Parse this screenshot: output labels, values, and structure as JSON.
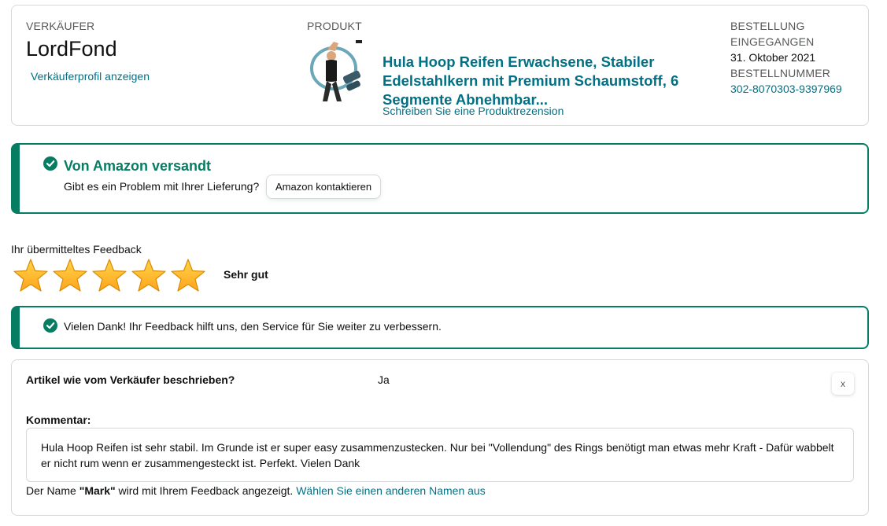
{
  "order": {
    "seller_label": "VERKÄUFER",
    "seller_name": "LordFond",
    "seller_profile_link": "Verkäuferprofil anzeigen",
    "product_label": "PRODUKT",
    "product_title": "Hula Hoop Reifen Erwachsene, Stabiler Edelstahlkern mit Premium Schaumstoff, 6 Segmente Abnehmbar...",
    "product_review_link": "Schreiben Sie eine Produktrezension",
    "received_label_1": "BESTELLUNG",
    "received_label_2": "EINGEGANGEN",
    "order_date": "31. Oktober 2021",
    "order_number_label": "BESTELLNUMMER",
    "order_number": "302-8070303-9397969"
  },
  "shipping": {
    "title": "Von Amazon versandt",
    "question": "Gibt es ein Problem mit Ihrer Lieferung?",
    "contact_button": "Amazon kontaktieren"
  },
  "rating": {
    "label": "Ihr übermitteltes Feedback",
    "stars": 5,
    "max_stars": 5,
    "text": "Sehr gut"
  },
  "thanks": {
    "text": "Vielen Dank! Ihr Feedback hilft uns, den Service für Sie weiter zu verbessern."
  },
  "feedback": {
    "question": "Artikel wie vom Verkäufer beschrieben?",
    "answer": "Ja",
    "close": "x",
    "comment_label": "Kommentar:",
    "comment": "Hula Hoop Reifen ist sehr stabil. Im Grunde ist er super easy zusammenzustecken. Nur bei \"Vollendung\" des Rings benötigt man etwas mehr Kraft - Dafür wabbelt er nicht rum wenn er zusammengesteckt ist. Perfekt. Vielen Dank",
    "name_prefix": "Der Name",
    "name_value": "\"Mark\"",
    "name_suffix": "wird mit Ihrem Feedback angezeigt.",
    "change_name_link": "Wählen Sie einen anderen Namen aus"
  },
  "colors": {
    "link": "#007185",
    "success": "#067d62",
    "star": "#ffa41c",
    "border": "#d5d9d9"
  },
  "icons": [
    "check-icon",
    "star-icon",
    "close-icon"
  ]
}
